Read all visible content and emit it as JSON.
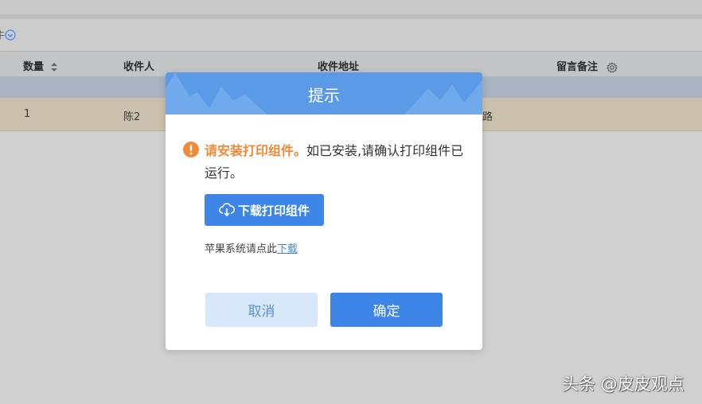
{
  "toolbar": {
    "fragment": "牛"
  },
  "table": {
    "headers": {
      "quantity": "数量",
      "recipient": "收件人",
      "address": "收件地址",
      "remark": "留言备注"
    },
    "row": {
      "quantity": "1",
      "recipient": "陈2",
      "address_fragment": "路"
    }
  },
  "dialog": {
    "title": "提示",
    "message_strong": "请安装打印组件。",
    "message_rest": "如已安装,请确认打印组件已运行。",
    "download_button": "下载打印组件",
    "mac_text": "苹果系统请点此",
    "mac_link": "下载",
    "cancel_button": "取消",
    "ok_button": "确定"
  },
  "watermark": "头条 @皮皮观点",
  "colors": {
    "primary": "#3d86e8",
    "warning": "#f08a3a",
    "header_blue": "#5a9ae6",
    "cancel_bg": "#d9e7fb"
  }
}
